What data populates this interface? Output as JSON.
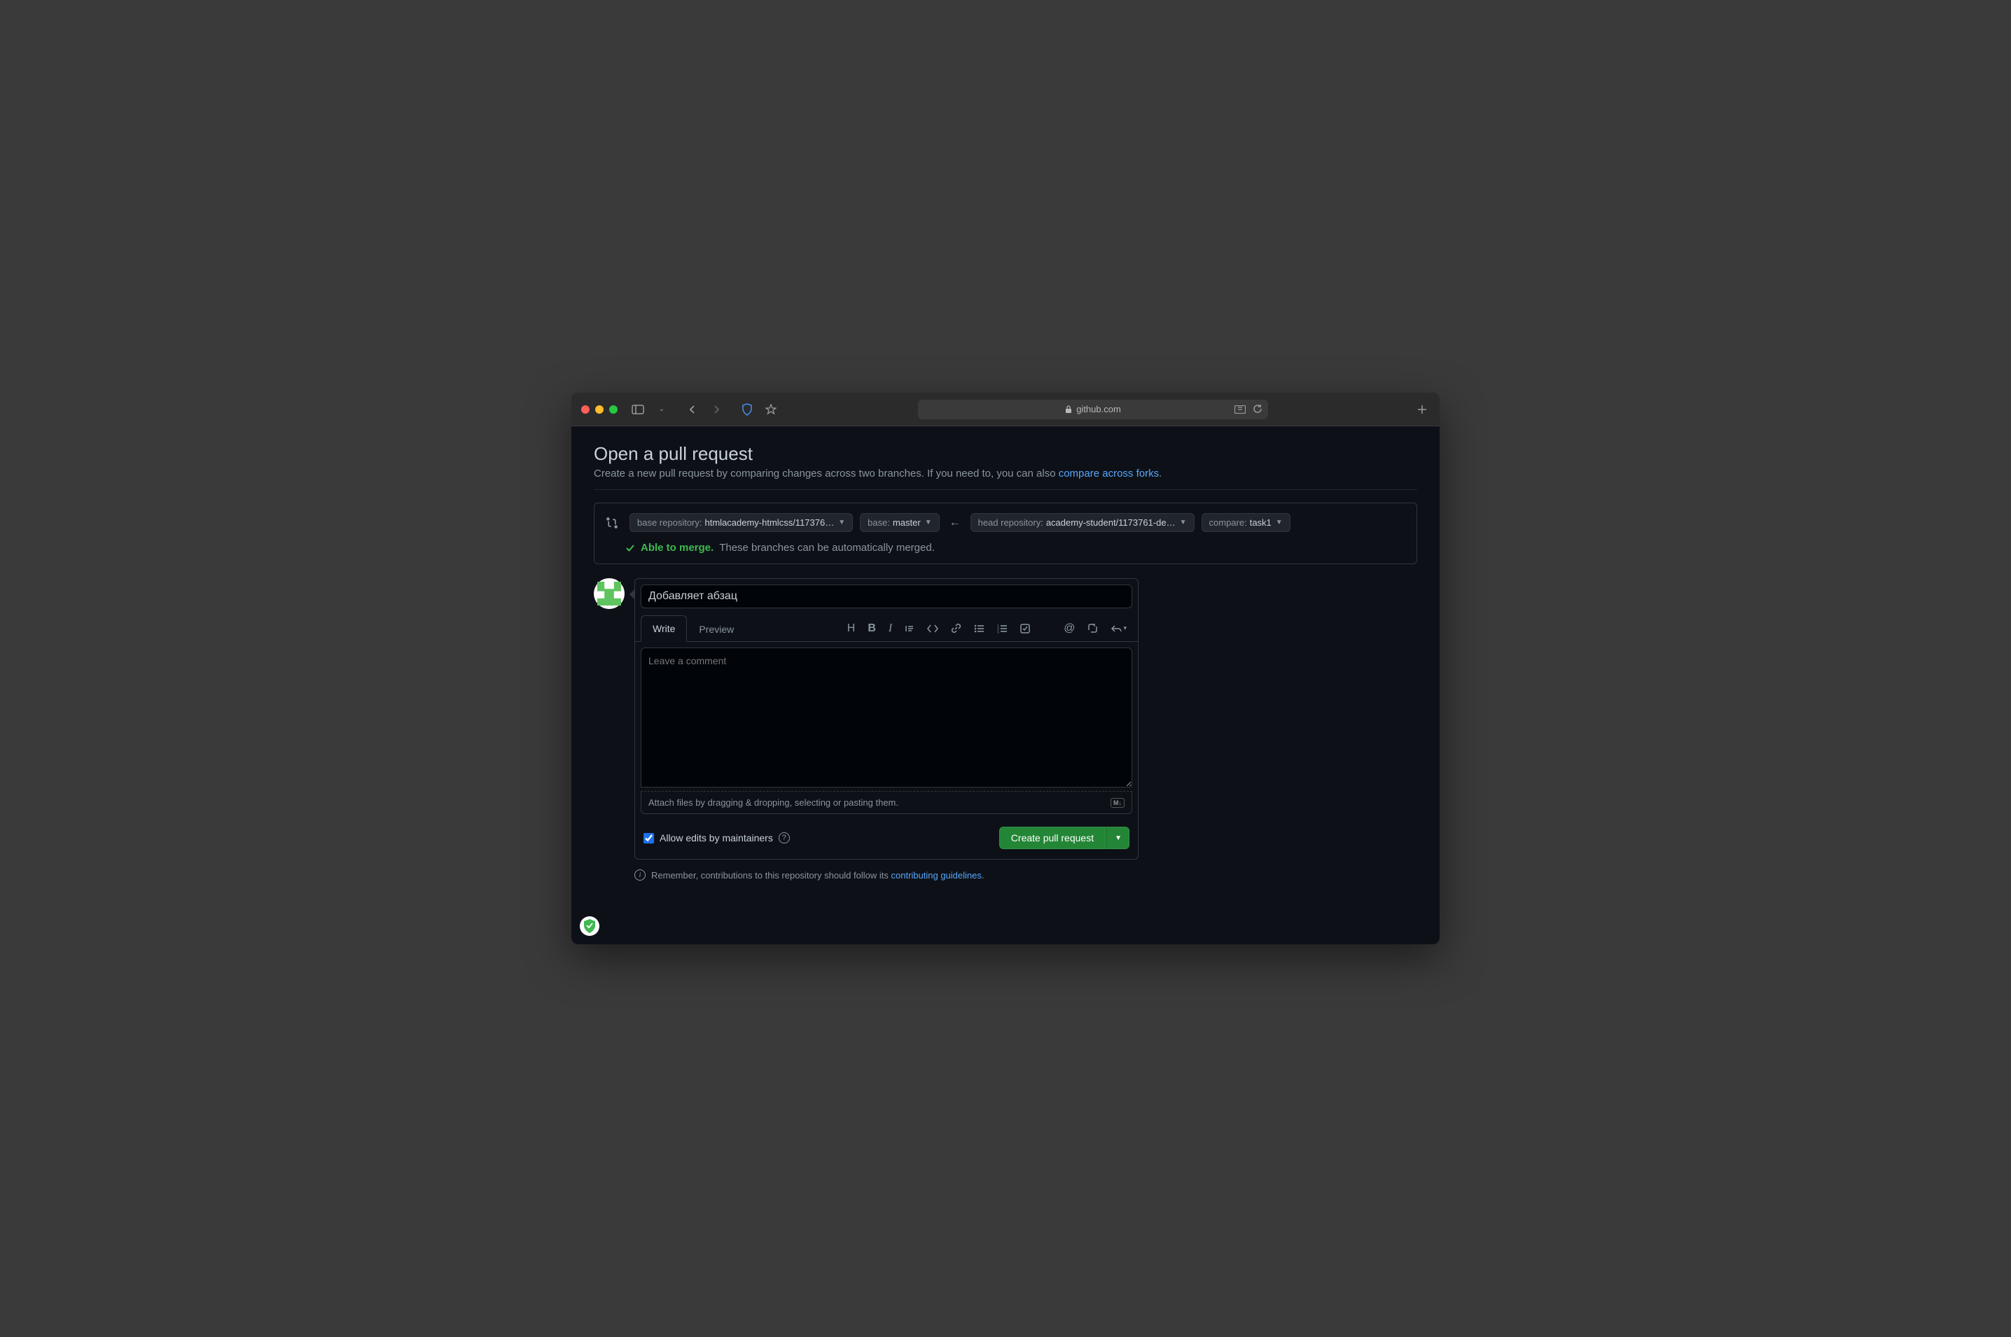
{
  "browser": {
    "url": "github.com"
  },
  "page": {
    "heading": "Open a pull request",
    "subtitle_pre": "Create a new pull request by comparing changes across two branches. If you need to, you can also ",
    "subtitle_link": "compare across forks",
    "subtitle_post": "."
  },
  "branch": {
    "base_repo_label": "base repository: ",
    "base_repo_value": "htmlacademy-htmlcss/117376…",
    "base_label": "base: ",
    "base_value": "master",
    "head_repo_label": "head repository: ",
    "head_repo_value": "academy-student/1173761-de…",
    "compare_label": "compare: ",
    "compare_value": "task1"
  },
  "merge": {
    "status": "Able to merge.",
    "message": "These branches can be automatically merged."
  },
  "pr": {
    "title_value": "Добавляет абзац",
    "tabs": {
      "write": "Write",
      "preview": "Preview"
    },
    "comment_placeholder": "Leave a comment",
    "attach_hint": "Attach files by dragging & dropping, selecting or pasting them.",
    "allow_edits_label": "Allow edits by maintainers",
    "create_button": "Create pull request"
  },
  "reminder": {
    "pre": "Remember, contributions to this repository should follow its ",
    "link": "contributing guidelines",
    "post": "."
  },
  "md_badge": "M↓"
}
